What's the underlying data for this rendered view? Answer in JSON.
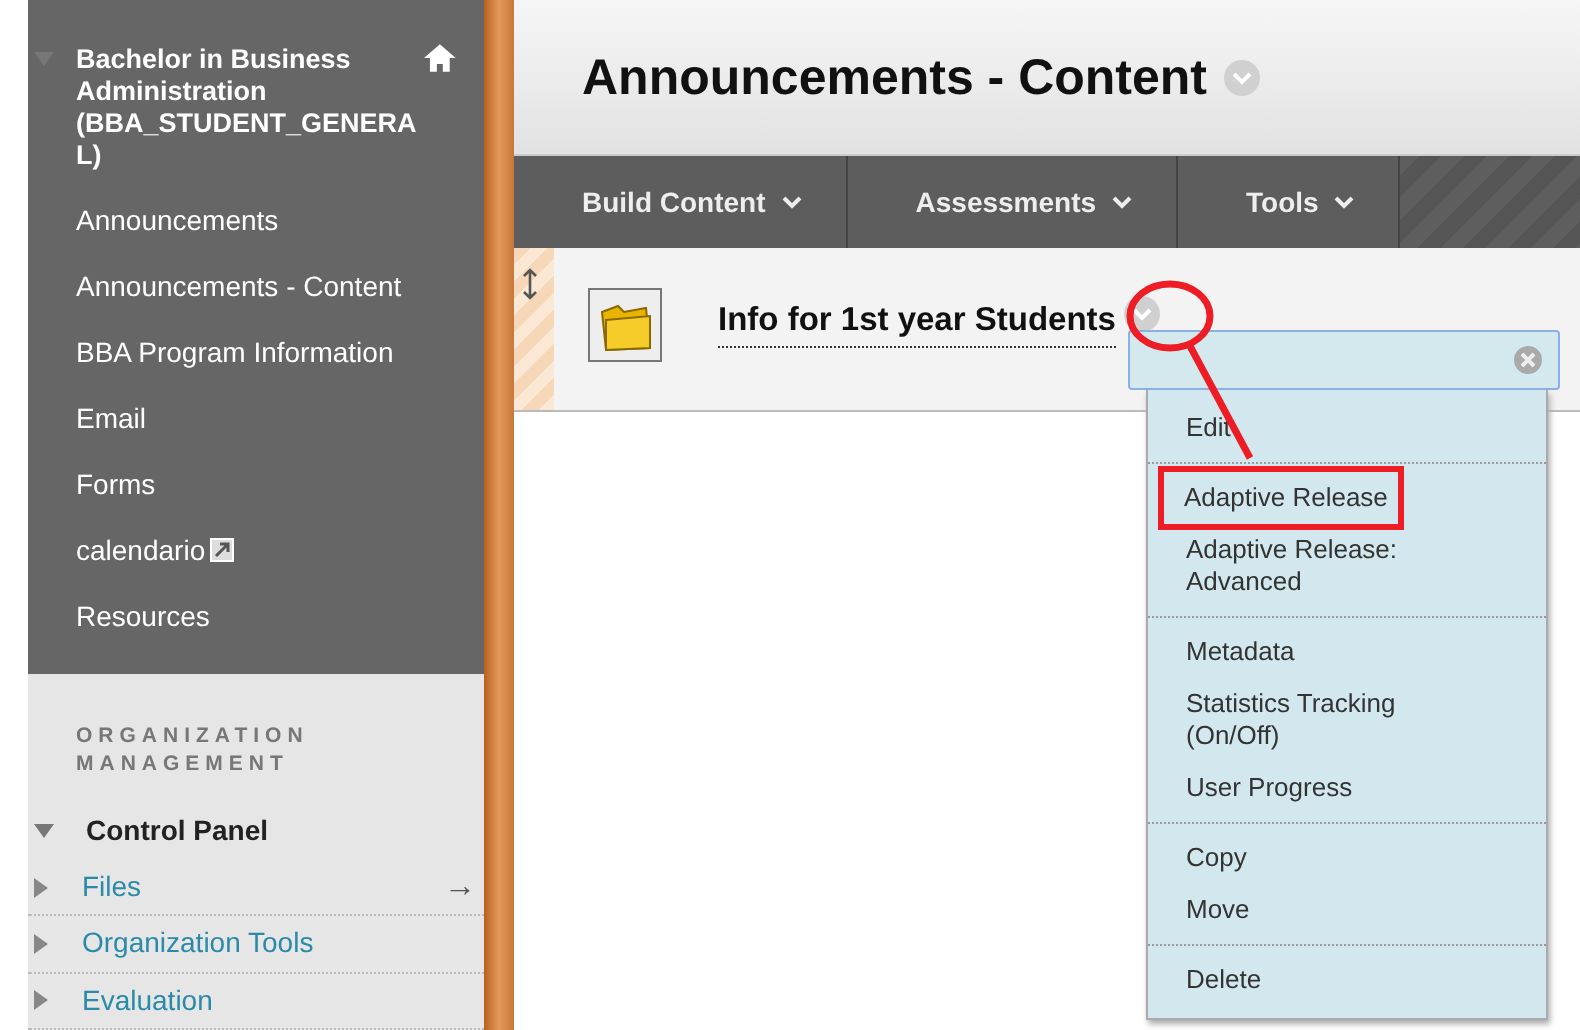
{
  "course": {
    "title": "Bachelor in Business Administration (BBA_STUDENT_GENERAL)"
  },
  "course_menu": [
    {
      "label": "Announcements",
      "kind": "link"
    },
    {
      "label": "Announcements - Content",
      "kind": "link"
    },
    {
      "label": "BBA Program Information",
      "kind": "link"
    },
    {
      "label": "Email",
      "kind": "link"
    },
    {
      "label": "Forms",
      "kind": "link"
    },
    {
      "label": "calendario",
      "kind": "external"
    },
    {
      "label": "Resources",
      "kind": "link"
    }
  ],
  "management": {
    "heading": "ORGANIZATION MANAGEMENT",
    "control_panel": {
      "label": "Control Panel",
      "expanded": true,
      "children": [
        {
          "label": "Files",
          "expanded": false,
          "trailing": "→"
        },
        {
          "label": "Organization Tools",
          "expanded": false
        },
        {
          "label": "Evaluation",
          "expanded": false
        }
      ]
    }
  },
  "page_title": "Announcements - Content",
  "toolbar": [
    {
      "label": "Build Content"
    },
    {
      "label": "Assessments"
    },
    {
      "label": "Tools"
    }
  ],
  "content_items": [
    {
      "title": "Info for 1st year Students"
    }
  ],
  "context_menu": {
    "groups": [
      [
        {
          "label": "Edit",
          "annotated": false
        }
      ],
      [
        {
          "label": "Adaptive Release",
          "annotated": true
        },
        {
          "label": "Adaptive Release: Advanced",
          "annotated": false
        }
      ],
      [
        {
          "label": "Metadata",
          "annotated": false
        },
        {
          "label": "Statistics Tracking (On/Off)",
          "annotated": false
        },
        {
          "label": "User Progress",
          "annotated": false
        }
      ],
      [
        {
          "label": "Copy",
          "annotated": false
        },
        {
          "label": "Move",
          "annotated": false
        }
      ],
      [
        {
          "label": "Delete",
          "annotated": false
        }
      ]
    ]
  }
}
